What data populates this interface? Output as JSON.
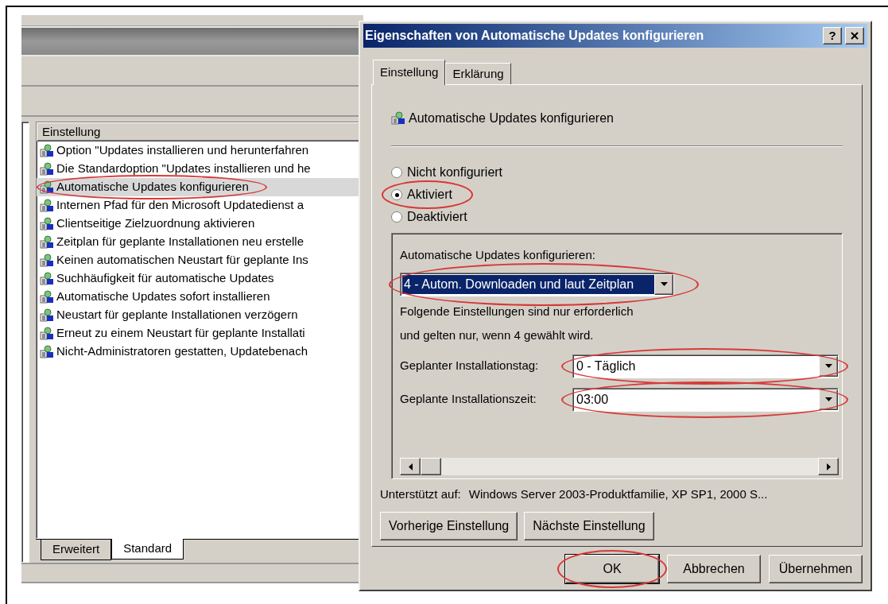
{
  "background_window": {
    "list_header": "Einstellung",
    "items": [
      {
        "label": "Option \"Updates installieren und herunterfahren",
        "selected": false,
        "highlighted": false
      },
      {
        "label": "Die Standardoption \"Updates installieren und he",
        "selected": false,
        "highlighted": false
      },
      {
        "label": "Automatische Updates konfigurieren",
        "selected": true,
        "highlighted": true
      },
      {
        "label": "Internen Pfad für den Microsoft Updatedienst a",
        "selected": false,
        "highlighted": false
      },
      {
        "label": "Clientseitige Zielzuordnung aktivieren",
        "selected": false,
        "highlighted": false
      },
      {
        "label": "Zeitplan für geplante Installationen neu erstelle",
        "selected": false,
        "highlighted": false
      },
      {
        "label": "Keinen automatischen Neustart für geplante Ins",
        "selected": false,
        "highlighted": false
      },
      {
        "label": "Suchhäufigkeit für automatische Updates",
        "selected": false,
        "highlighted": false
      },
      {
        "label": "Automatische Updates sofort installieren",
        "selected": false,
        "highlighted": false
      },
      {
        "label": "Neustart für geplante Installationen verzögern",
        "selected": false,
        "highlighted": false
      },
      {
        "label": "Erneut zu einem Neustart für geplante Installati",
        "selected": false,
        "highlighted": false
      },
      {
        "label": "Nicht-Administratoren gestatten, Updatebenach",
        "selected": false,
        "highlighted": false
      }
    ],
    "view_tabs": [
      {
        "label": "Erweitert",
        "selected": false
      },
      {
        "label": "Standard",
        "selected": true
      }
    ]
  },
  "dialog": {
    "title": "Eigenschaften von Automatische Updates konfigurieren",
    "help_button": "?",
    "tabs": [
      {
        "label": "Einstellung",
        "selected": true
      },
      {
        "label": "Erklärung",
        "selected": false
      }
    ],
    "heading": "Automatische Updates konfigurieren",
    "options": [
      {
        "label": "Nicht konfiguriert",
        "selected": false,
        "highlighted": false
      },
      {
        "label": "Aktiviert",
        "selected": true,
        "highlighted": true
      },
      {
        "label": "Deaktiviert",
        "selected": false,
        "highlighted": false
      }
    ],
    "group": {
      "label": "Automatische Updates konfigurieren:",
      "mode": {
        "value": "4 - Autom. Downloaden und laut Zeitplan",
        "highlighted": true
      },
      "note_lines": [
        "Folgende Einstellungen sind nur erforderlich",
        "und gelten nur, wenn 4 gewählt wird."
      ],
      "fields": [
        {
          "label": "Geplanter Installationstag:",
          "value": "0 - Täglich",
          "highlighted": true
        },
        {
          "label": "Geplante Installationszeit:",
          "value": "03:00",
          "highlighted": true
        }
      ]
    },
    "supported_label": "Unterstützt auf:",
    "supported_value": "Windows Server 2003-Produktfamilie, XP SP1, 2000 S...",
    "nav_buttons": [
      "Vorherige Einstellung",
      "Nächste Einstellung"
    ],
    "buttons": [
      {
        "label": "OK",
        "highlighted": true
      },
      {
        "label": "Abbrechen",
        "highlighted": false
      },
      {
        "label": "Übernehmen",
        "highlighted": false
      }
    ]
  }
}
